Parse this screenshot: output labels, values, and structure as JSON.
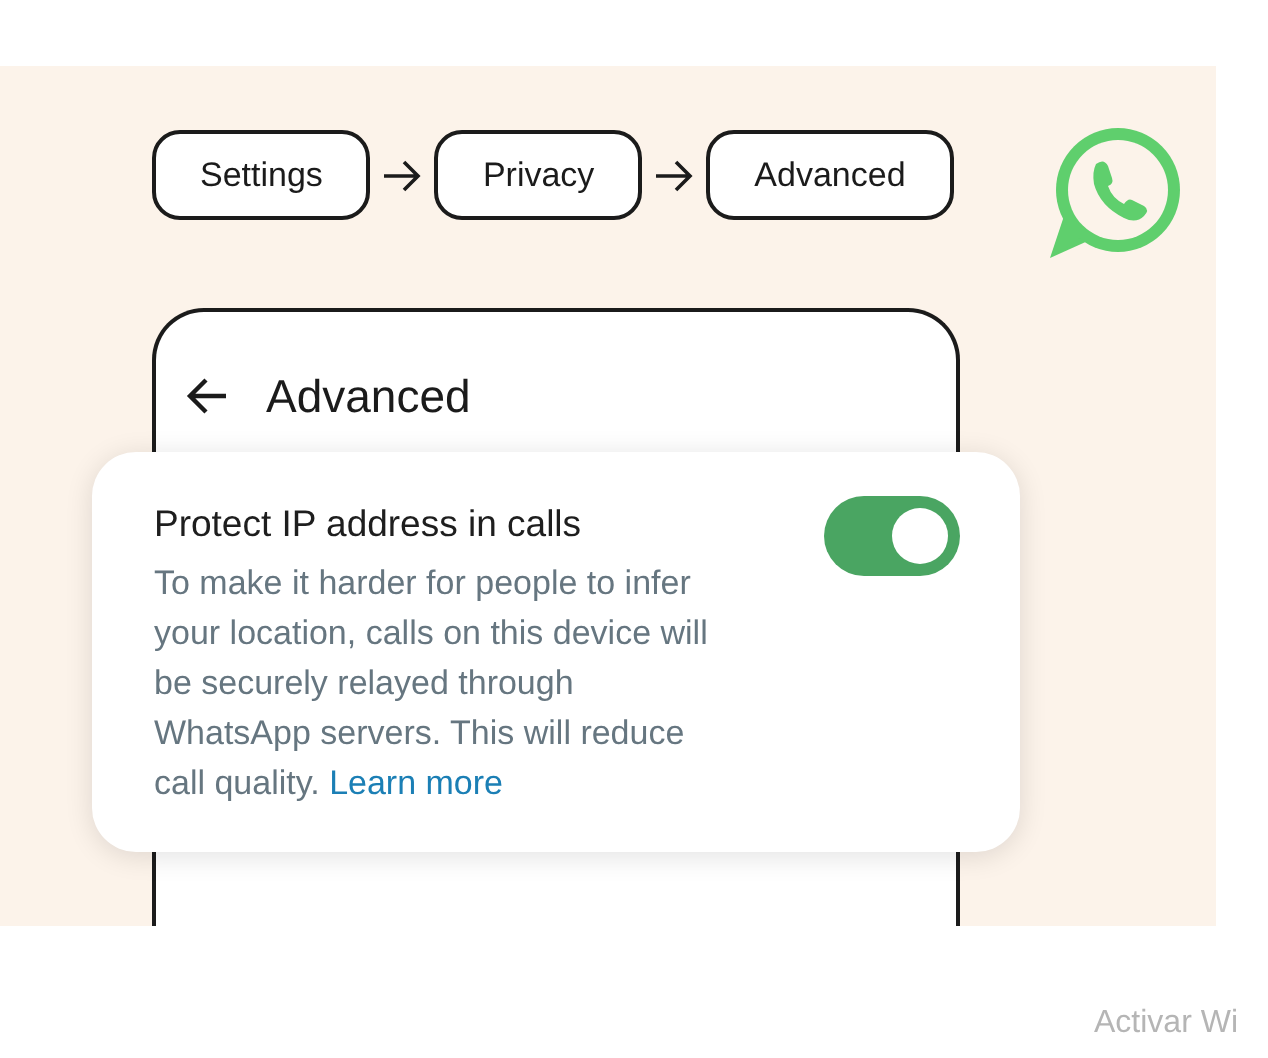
{
  "breadcrumb": [
    {
      "label": "Settings"
    },
    {
      "label": "Privacy"
    },
    {
      "label": "Advanced"
    }
  ],
  "screen": {
    "title": "Advanced"
  },
  "setting": {
    "title": "Protect IP address in calls",
    "description": "To make it harder for people to infer your location, calls on this device will be securely relayed through WhatsApp servers. This will reduce call quality.",
    "link": "Learn more",
    "on": true
  },
  "os_notice": "Activar Wi"
}
